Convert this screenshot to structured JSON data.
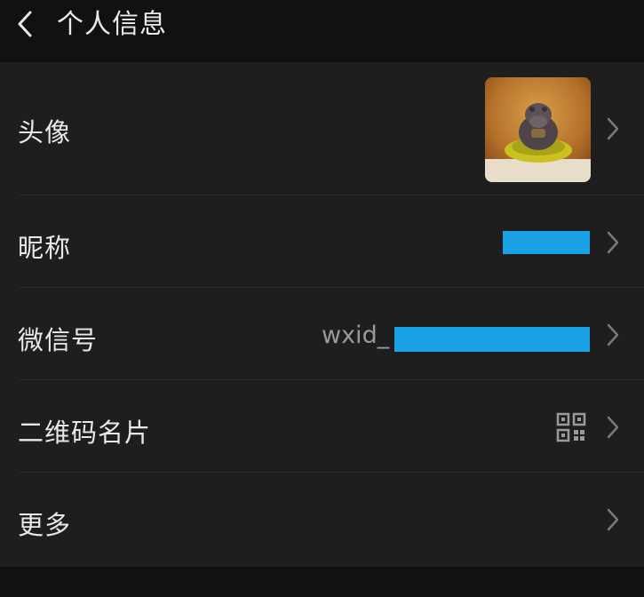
{
  "header": {
    "title": "个人信息"
  },
  "rows": {
    "avatar": {
      "label": "头像"
    },
    "nickname": {
      "label": "昵称"
    },
    "wechat_id": {
      "label": "微信号",
      "value_prefix": "wxid_"
    },
    "qr_card": {
      "label": "二维码名片"
    },
    "more": {
      "label": "更多"
    }
  },
  "icons": {
    "back": "chevron-left-icon",
    "chevron": "chevron-right-icon",
    "qr": "qr-code-icon"
  },
  "colors": {
    "background": "#111111",
    "row_background": "#1e1e1e",
    "redaction": "#1aa1e6"
  }
}
